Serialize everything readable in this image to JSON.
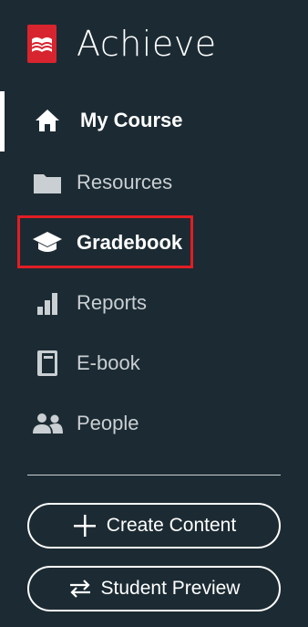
{
  "brand": {
    "name": "Achieve",
    "logo_color": "#d8242e"
  },
  "nav": {
    "items": [
      {
        "label": "My Course",
        "icon": "home-icon"
      },
      {
        "label": "Resources",
        "icon": "folder-icon"
      },
      {
        "label": "Gradebook",
        "icon": "graduation-cap-icon"
      },
      {
        "label": "Reports",
        "icon": "bar-chart-icon"
      },
      {
        "label": "E-book",
        "icon": "book-icon"
      },
      {
        "label": "People",
        "icon": "people-icon"
      }
    ]
  },
  "actions": {
    "create_content": "Create Content",
    "student_preview": "Student Preview"
  },
  "colors": {
    "background": "#1c2b33",
    "highlight": "#e21d24",
    "muted_text": "#c9cfd3"
  }
}
